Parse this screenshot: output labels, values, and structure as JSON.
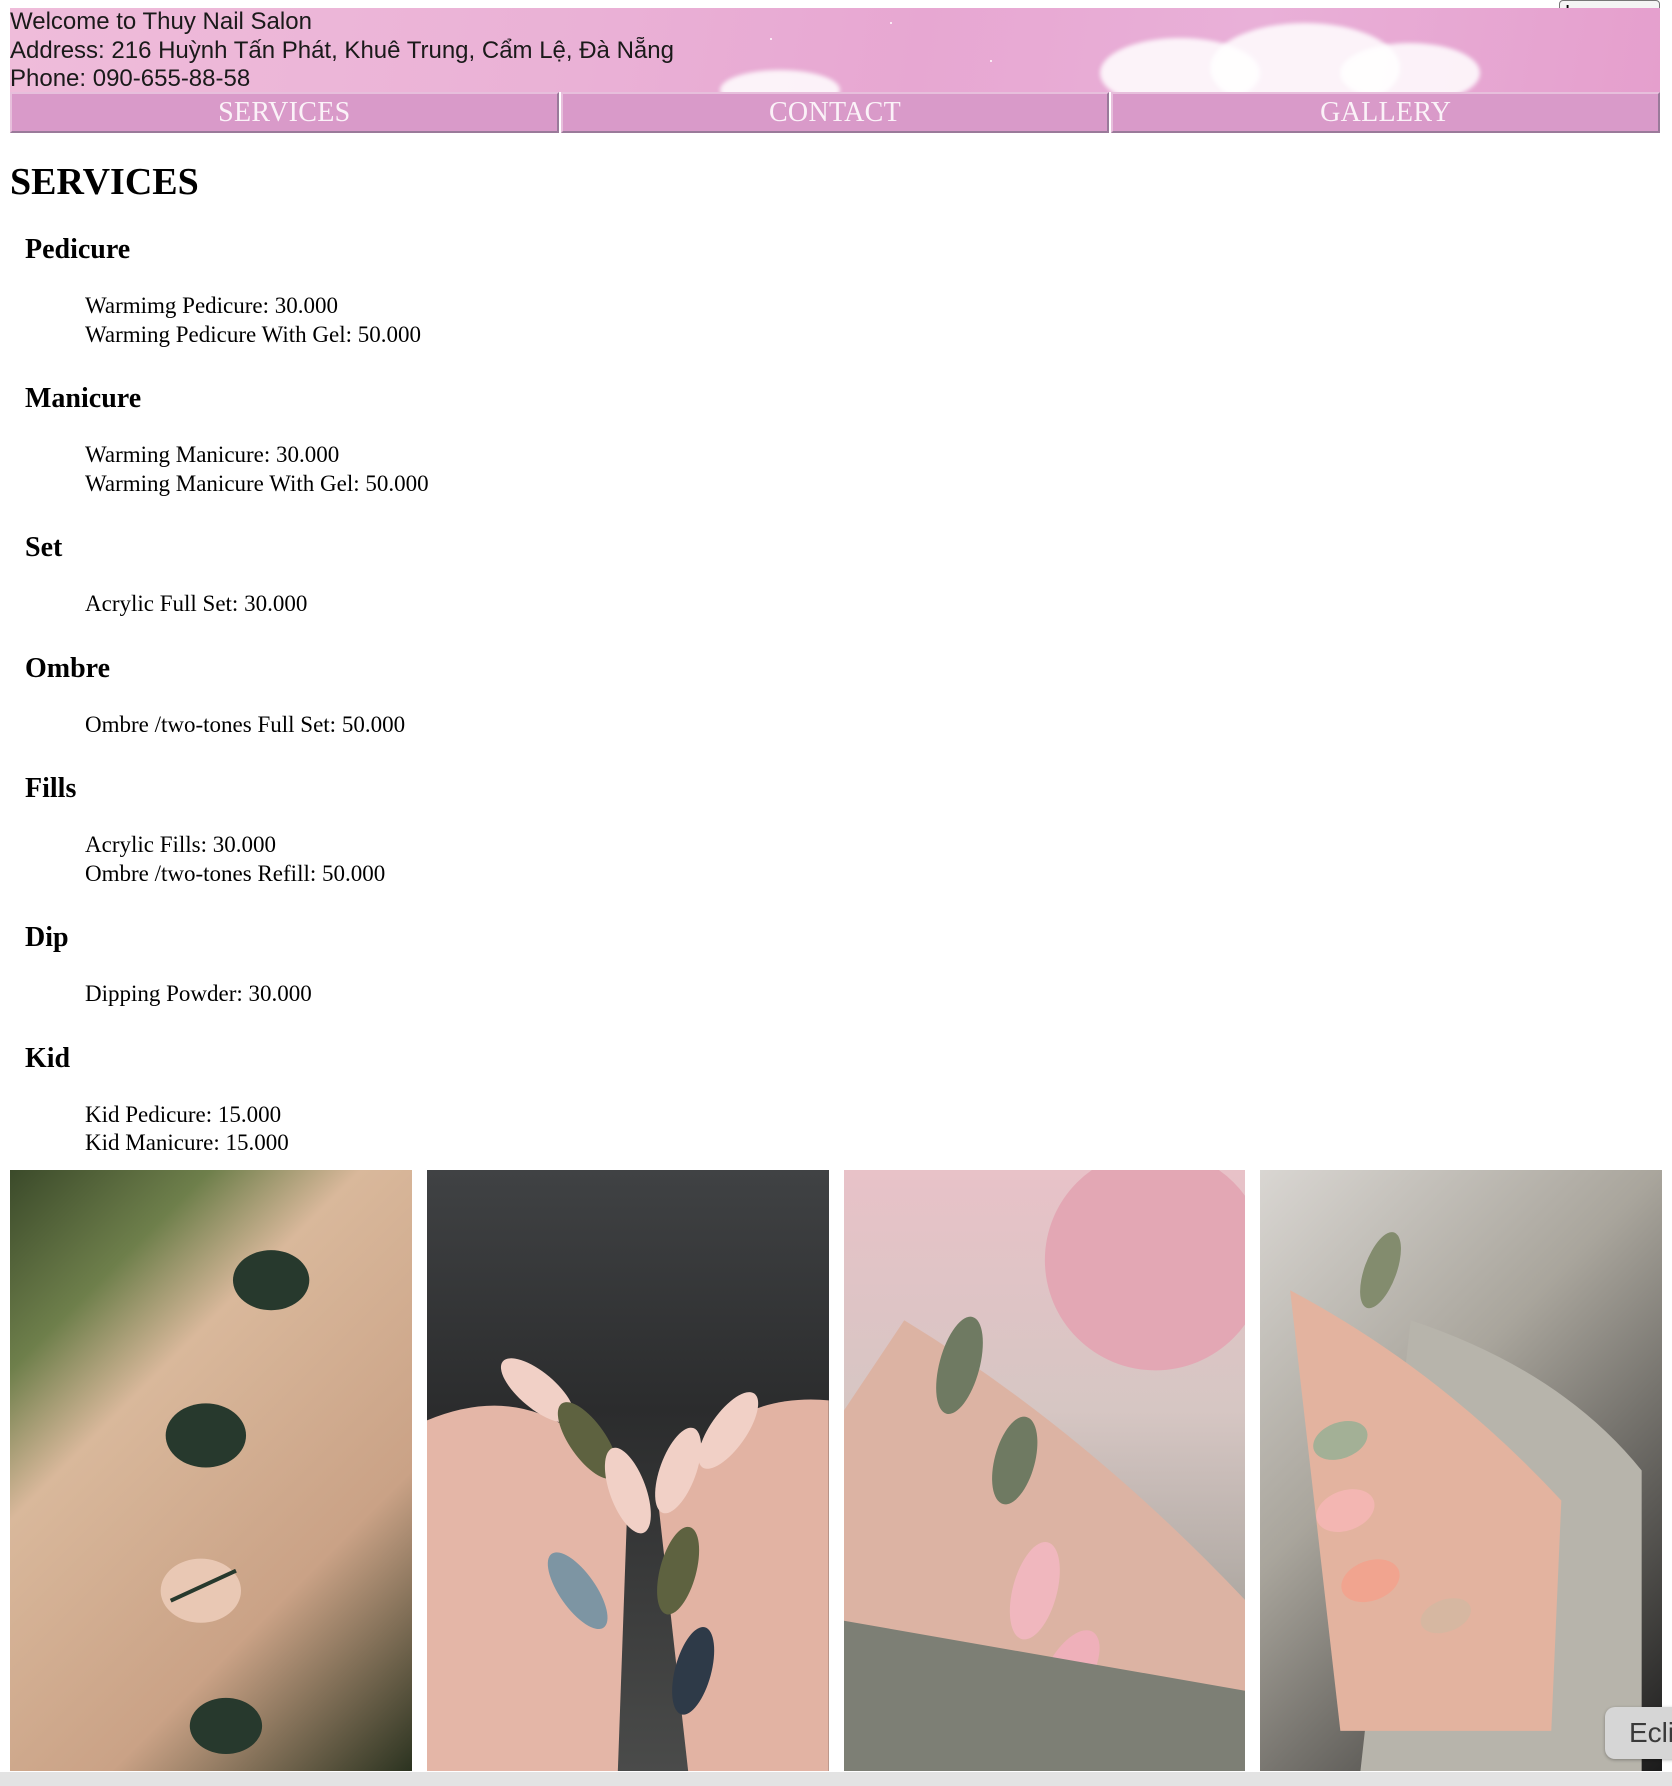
{
  "language_button": "Language",
  "banner": {
    "welcome": "Welcome to Thuy Nail Salon",
    "address": "Address: 216 Huỳnh Tấn Phát, Khuê Trung, Cẩm Lệ, Đà Nẵng",
    "phone": "Phone: 090-655-88-58"
  },
  "nav": [
    "SERVICES",
    "CONTACT",
    "GALLERY"
  ],
  "page_title": "SERVICES",
  "categories": [
    {
      "title": "Pedicure",
      "items": [
        "Warmimg Pedicure: 30.000",
        "Warming Pedicure With Gel: 50.000"
      ]
    },
    {
      "title": "Manicure",
      "items": [
        "Warming Manicure: 30.000",
        "Warming Manicure With Gel: 50.000"
      ]
    },
    {
      "title": "Set",
      "items": [
        "Acrylic Full Set: 30.000"
      ]
    },
    {
      "title": "Ombre",
      "items": [
        "Ombre /two-tones Full Set: 50.000"
      ]
    },
    {
      "title": "Fills",
      "items": [
        "Acrylic Fills: 30.000",
        "Ombre /two-tones Refill: 50.000"
      ]
    },
    {
      "title": "Dip",
      "items": [
        "Dipping Powder: 30.000"
      ]
    },
    {
      "title": "Kid",
      "items": [
        "Kid Pedicure: 15.000",
        "Kid Manicure: 15.000"
      ]
    }
  ],
  "gallery": [
    "green-nails-photo",
    "floral-nails-photo",
    "sage-pink-nails-photo",
    "sweater-nails-photo"
  ],
  "floating_button": "Ecli",
  "colors": {
    "banner_pink": "#e7a7d2",
    "nav_pink": "#d99ac9",
    "nav_text": "#fbf2f8"
  }
}
